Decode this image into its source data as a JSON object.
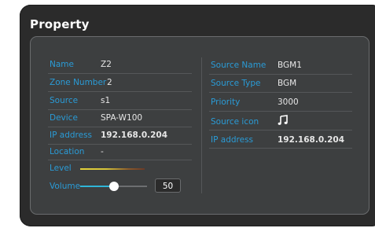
{
  "panel": {
    "title": "Property"
  },
  "left": {
    "name_label": "Name",
    "name_value": "Z2",
    "zone_number_label": "Zone Number",
    "zone_number_value": "2",
    "source_label": "Source",
    "source_value": "s1",
    "device_label": "Device",
    "device_value": "SPA-W100",
    "ip_label": "IP address",
    "ip_value": "192.168.0.204",
    "location_label": "Location",
    "location_value": "-",
    "level_label": "Level",
    "volume_label": "Volume",
    "volume_value": "50",
    "volume_fraction": 0.5
  },
  "right": {
    "source_name_label": "Source Name",
    "source_name_value": "BGM1",
    "source_type_label": "Source Type",
    "source_type_value": "BGM",
    "priority_label": "Priority",
    "priority_value": "3000",
    "source_icon_label": "Source icon",
    "source_icon_name": "music-note-icon",
    "ip_label": "IP address",
    "ip_value": "192.168.0.204"
  },
  "colors": {
    "label": "#2a9bd6",
    "accent": "#2fb5d8",
    "panel": "#2b2b2b",
    "inner": "#3d3f40"
  }
}
